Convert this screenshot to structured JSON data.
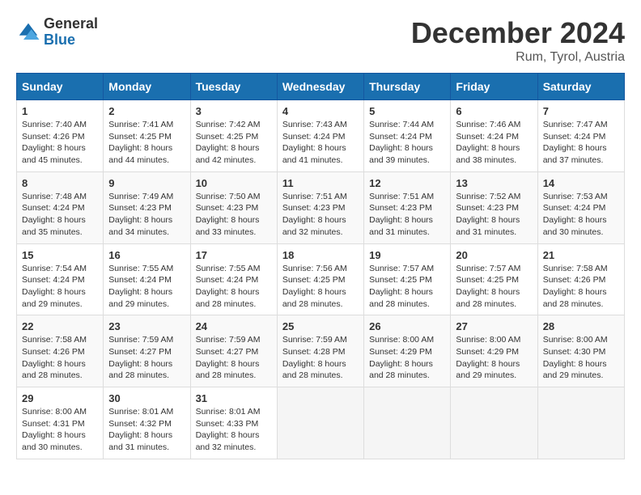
{
  "header": {
    "logo_general": "General",
    "logo_blue": "Blue",
    "title": "December 2024",
    "location": "Rum, Tyrol, Austria"
  },
  "days_of_week": [
    "Sunday",
    "Monday",
    "Tuesday",
    "Wednesday",
    "Thursday",
    "Friday",
    "Saturday"
  ],
  "weeks": [
    [
      {
        "day": "1",
        "sunrise": "7:40 AM",
        "sunset": "4:26 PM",
        "daylight": "8 hours and 45 minutes."
      },
      {
        "day": "2",
        "sunrise": "7:41 AM",
        "sunset": "4:25 PM",
        "daylight": "8 hours and 44 minutes."
      },
      {
        "day": "3",
        "sunrise": "7:42 AM",
        "sunset": "4:25 PM",
        "daylight": "8 hours and 42 minutes."
      },
      {
        "day": "4",
        "sunrise": "7:43 AM",
        "sunset": "4:24 PM",
        "daylight": "8 hours and 41 minutes."
      },
      {
        "day": "5",
        "sunrise": "7:44 AM",
        "sunset": "4:24 PM",
        "daylight": "8 hours and 39 minutes."
      },
      {
        "day": "6",
        "sunrise": "7:46 AM",
        "sunset": "4:24 PM",
        "daylight": "8 hours and 38 minutes."
      },
      {
        "day": "7",
        "sunrise": "7:47 AM",
        "sunset": "4:24 PM",
        "daylight": "8 hours and 37 minutes."
      }
    ],
    [
      {
        "day": "8",
        "sunrise": "7:48 AM",
        "sunset": "4:24 PM",
        "daylight": "8 hours and 35 minutes."
      },
      {
        "day": "9",
        "sunrise": "7:49 AM",
        "sunset": "4:23 PM",
        "daylight": "8 hours and 34 minutes."
      },
      {
        "day": "10",
        "sunrise": "7:50 AM",
        "sunset": "4:23 PM",
        "daylight": "8 hours and 33 minutes."
      },
      {
        "day": "11",
        "sunrise": "7:51 AM",
        "sunset": "4:23 PM",
        "daylight": "8 hours and 32 minutes."
      },
      {
        "day": "12",
        "sunrise": "7:51 AM",
        "sunset": "4:23 PM",
        "daylight": "8 hours and 31 minutes."
      },
      {
        "day": "13",
        "sunrise": "7:52 AM",
        "sunset": "4:23 PM",
        "daylight": "8 hours and 31 minutes."
      },
      {
        "day": "14",
        "sunrise": "7:53 AM",
        "sunset": "4:24 PM",
        "daylight": "8 hours and 30 minutes."
      }
    ],
    [
      {
        "day": "15",
        "sunrise": "7:54 AM",
        "sunset": "4:24 PM",
        "daylight": "8 hours and 29 minutes."
      },
      {
        "day": "16",
        "sunrise": "7:55 AM",
        "sunset": "4:24 PM",
        "daylight": "8 hours and 29 minutes."
      },
      {
        "day": "17",
        "sunrise": "7:55 AM",
        "sunset": "4:24 PM",
        "daylight": "8 hours and 28 minutes."
      },
      {
        "day": "18",
        "sunrise": "7:56 AM",
        "sunset": "4:25 PM",
        "daylight": "8 hours and 28 minutes."
      },
      {
        "day": "19",
        "sunrise": "7:57 AM",
        "sunset": "4:25 PM",
        "daylight": "8 hours and 28 minutes."
      },
      {
        "day": "20",
        "sunrise": "7:57 AM",
        "sunset": "4:25 PM",
        "daylight": "8 hours and 28 minutes."
      },
      {
        "day": "21",
        "sunrise": "7:58 AM",
        "sunset": "4:26 PM",
        "daylight": "8 hours and 28 minutes."
      }
    ],
    [
      {
        "day": "22",
        "sunrise": "7:58 AM",
        "sunset": "4:26 PM",
        "daylight": "8 hours and 28 minutes."
      },
      {
        "day": "23",
        "sunrise": "7:59 AM",
        "sunset": "4:27 PM",
        "daylight": "8 hours and 28 minutes."
      },
      {
        "day": "24",
        "sunrise": "7:59 AM",
        "sunset": "4:27 PM",
        "daylight": "8 hours and 28 minutes."
      },
      {
        "day": "25",
        "sunrise": "7:59 AM",
        "sunset": "4:28 PM",
        "daylight": "8 hours and 28 minutes."
      },
      {
        "day": "26",
        "sunrise": "8:00 AM",
        "sunset": "4:29 PM",
        "daylight": "8 hours and 28 minutes."
      },
      {
        "day": "27",
        "sunrise": "8:00 AM",
        "sunset": "4:29 PM",
        "daylight": "8 hours and 29 minutes."
      },
      {
        "day": "28",
        "sunrise": "8:00 AM",
        "sunset": "4:30 PM",
        "daylight": "8 hours and 29 minutes."
      }
    ],
    [
      {
        "day": "29",
        "sunrise": "8:00 AM",
        "sunset": "4:31 PM",
        "daylight": "8 hours and 30 minutes."
      },
      {
        "day": "30",
        "sunrise": "8:01 AM",
        "sunset": "4:32 PM",
        "daylight": "8 hours and 31 minutes."
      },
      {
        "day": "31",
        "sunrise": "8:01 AM",
        "sunset": "4:33 PM",
        "daylight": "8 hours and 32 minutes."
      },
      null,
      null,
      null,
      null
    ]
  ]
}
